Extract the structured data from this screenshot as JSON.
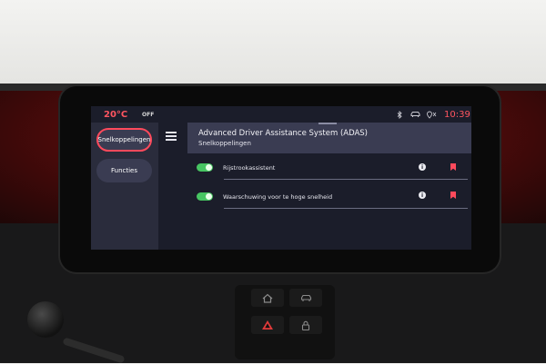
{
  "status_bar": {
    "temperature": "20°C",
    "climate_state": "OFF",
    "time": "10:39",
    "icons": [
      "bluetooth-icon",
      "car-icon",
      "location-muted-icon"
    ]
  },
  "sidebar": {
    "items": [
      {
        "label": "Snelkoppelingen",
        "active": true
      },
      {
        "label": "Functies",
        "active": false
      }
    ]
  },
  "header": {
    "title": "Advanced Driver Assistance System (ADAS)",
    "subtitle": "Snelkoppelingen"
  },
  "settings": [
    {
      "label": "Rijstrookassistent",
      "enabled": true
    },
    {
      "label": "Waarschuwing voor te hoge snelheid",
      "enabled": true
    }
  ],
  "physical_buttons": [
    "home-icon",
    "car-icon",
    "hazard-icon",
    "lock-icon"
  ],
  "colors": {
    "accent": "#ff4a5c",
    "toggle_on": "#47c562",
    "screen_bg": "#1b1d2a",
    "panel": "#3a3c52"
  }
}
